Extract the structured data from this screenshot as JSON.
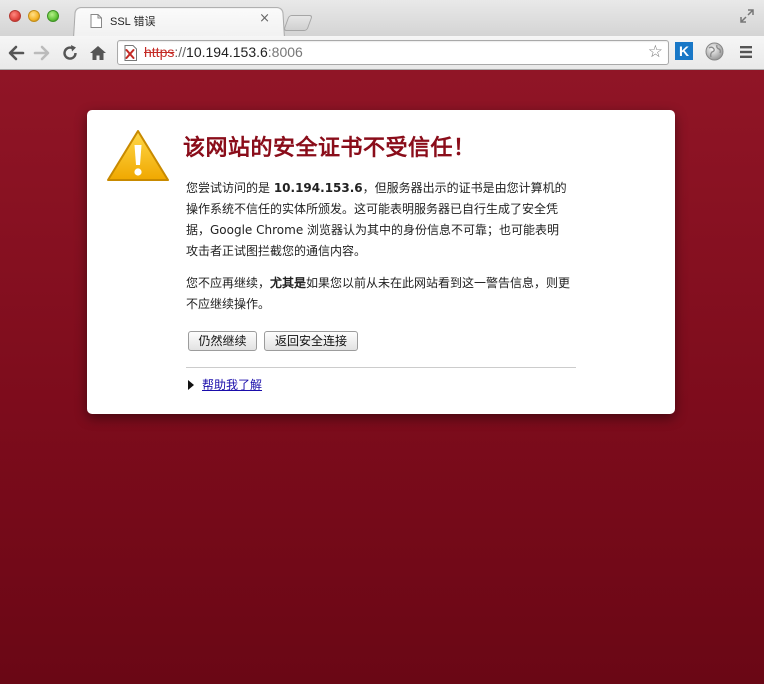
{
  "browser": {
    "tab_title": "SSL 错误",
    "tab_close": "×",
    "address": {
      "scheme": "https",
      "separator": "://",
      "host": "10.194.153.6",
      "port": ":8006"
    },
    "star_glyph": "☆",
    "extension_k": "K",
    "icons": [
      "back-icon",
      "forward-icon",
      "reload-icon",
      "home-icon",
      "insecure-lock-icon",
      "bookmark-star-icon",
      "globe-icon",
      "menu-icon",
      "fullscreen-icon",
      "page-icon"
    ]
  },
  "interstitial": {
    "heading": "该网站的安全证书不受信任！",
    "p1_prefix": "您尝试访问的是 ",
    "p1_host": "10.194.153.6",
    "p1_suffix": "，但服务器出示的证书是由您计算机的操作系统不信任的实体所颁发。这可能表明服务器已自行生成了安全凭据，Google Chrome 浏览器认为其中的身份信息不可靠；也可能表明攻击者正试图拦截您的通信内容。",
    "p2_prefix": "您不应再继续，",
    "p2_bold": "尤其是",
    "p2_suffix": "如果您以前从未在此网站看到这一警告信息，则更不应继续操作。",
    "proceed_button": "仍然继续",
    "back_button": "返回安全连接",
    "help_link": "帮助我了解",
    "colors": {
      "page_background": "#7a0f1e",
      "heading": "#8a0d1a",
      "warning_icon": "#f5b800",
      "link": "#1a0dab",
      "insecure_scheme": "#c42a25"
    }
  }
}
